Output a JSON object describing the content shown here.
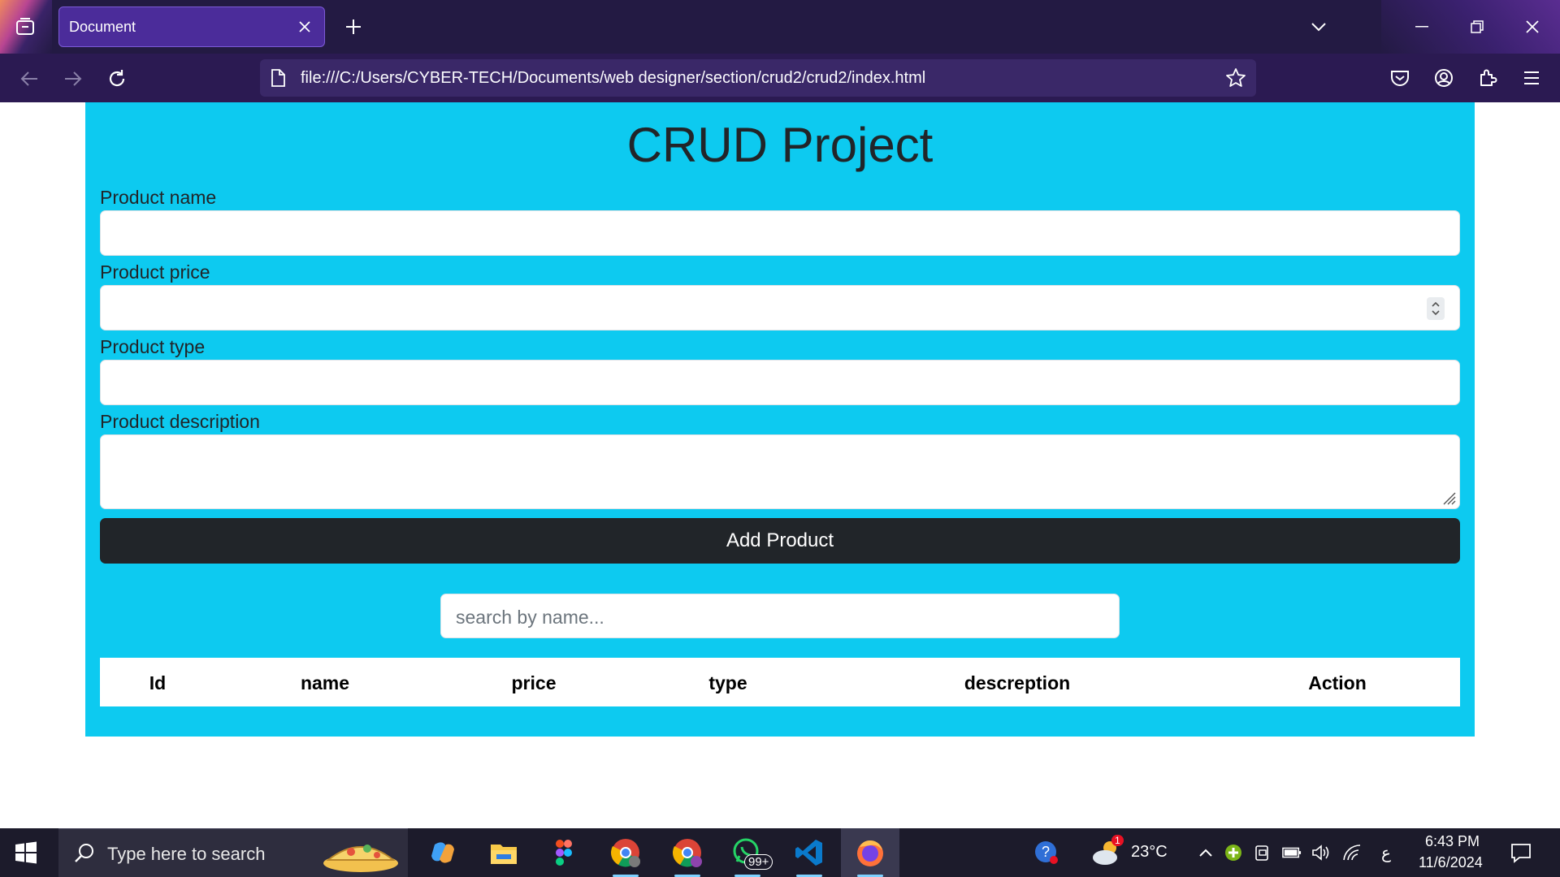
{
  "browser": {
    "tab_title": "Document",
    "url": "file:///C:/Users/CYBER-TECH/Documents/web designer/section/crud2/crud2/index.html"
  },
  "page": {
    "title": "CRUD Project",
    "fields": {
      "name_label": "Product name",
      "name_value": "",
      "price_label": "Product price",
      "price_value": "",
      "type_label": "Product type",
      "type_value": "",
      "description_label": "Product description",
      "description_value": ""
    },
    "add_button_label": "Add Product",
    "search_placeholder": "search by name...",
    "table_headers": [
      "Id",
      "name",
      "price",
      "type",
      "descreption",
      "Action"
    ]
  },
  "taskbar": {
    "search_placeholder": "Type here to search",
    "whatsapp_badge": "99+",
    "weather_badge": "1",
    "temperature": "23°C",
    "language": "ع",
    "time": "6:43 PM",
    "date": "11/6/2024"
  },
  "colors": {
    "accent": "#0dcaf0",
    "button_dark": "#212529",
    "browser_chrome": "#2b1a52"
  }
}
